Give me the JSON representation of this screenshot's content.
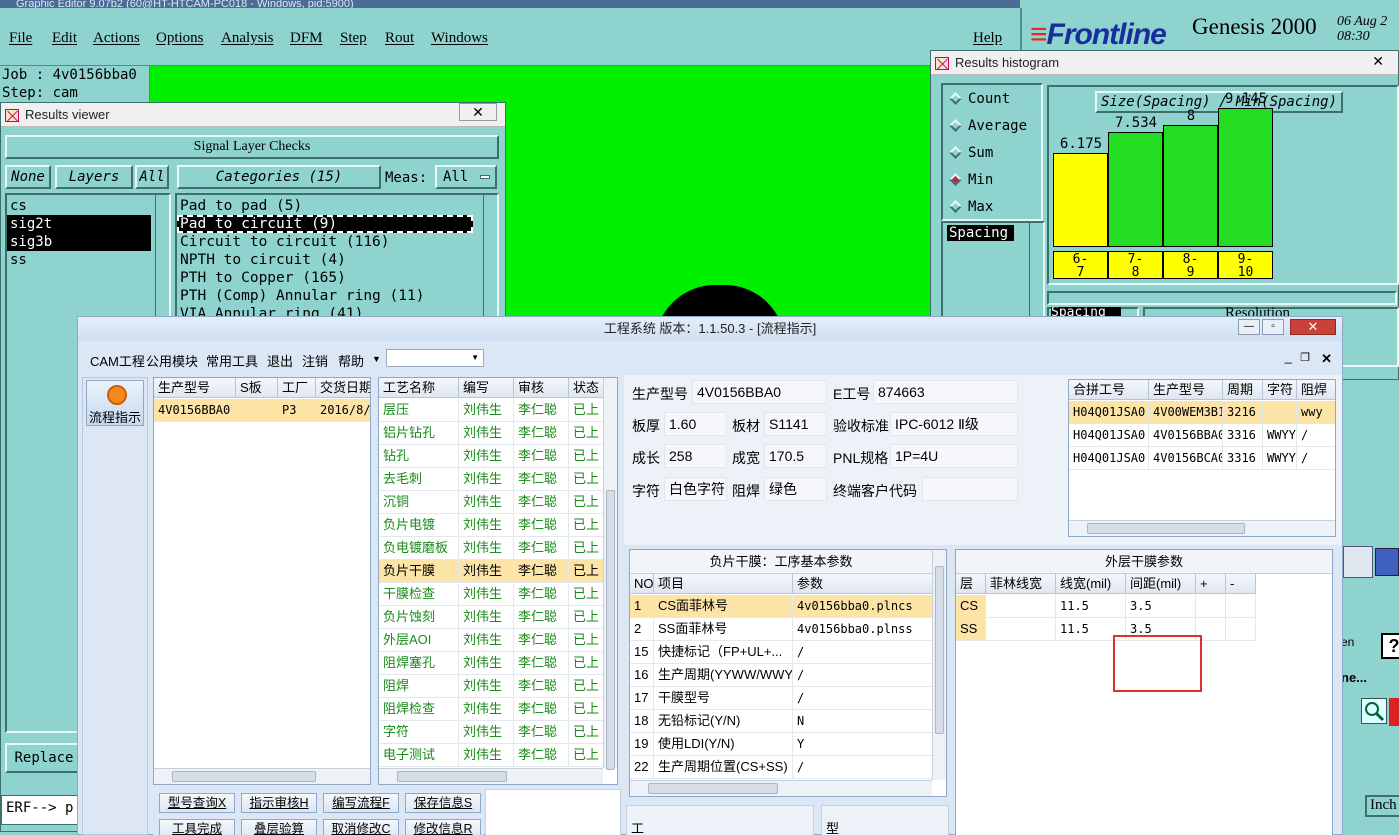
{
  "genesis": {
    "title_bar": "Graphic Editor 9.07b2 (60@HT-HTCAM-PC018 - Windows, pid:5900)",
    "menu": [
      "File",
      "Edit",
      "Actions",
      "Options",
      "Analysis",
      "DFM",
      "Step",
      "Rout",
      "Windows"
    ],
    "help": "Help",
    "brand": "Frontline",
    "product": "Genesis 2000",
    "date": "06 Aug 2",
    "time": "08:30",
    "job_label": "Job : 4v0156bba0",
    "step_label": "Step: cam"
  },
  "results_viewer": {
    "title": "Results viewer",
    "close": "✕",
    "header": "Signal Layer Checks",
    "none_btn": "None",
    "layers_btn": "Layers",
    "all_btn": "All",
    "categories_btn": "Categories (15)",
    "meas_label": "Meas:",
    "meas_value": "All",
    "layers": [
      {
        "name": "cs",
        "selected": false
      },
      {
        "name": "sig2t",
        "selected": true
      },
      {
        "name": "sig3b",
        "selected": true
      },
      {
        "name": "ss",
        "selected": false
      }
    ],
    "categories": [
      {
        "label": "Pad to pad (5)",
        "selected": false
      },
      {
        "label": "Pad to circuit (9)",
        "selected": true
      },
      {
        "label": "Circuit to circuit (116)",
        "selected": false
      },
      {
        "label": "NPTH to circuit (4)",
        "selected": false
      },
      {
        "label": "PTH to Copper (165)",
        "selected": false
      },
      {
        "label": "PTH (Comp) Annular ring (11)",
        "selected": false
      },
      {
        "label": "VIA Annular ring (41)",
        "selected": false
      }
    ],
    "replace_btn": "Replace",
    "erf_label": "ERF--> p"
  },
  "histogram": {
    "title": "Results histogram",
    "close": "✕",
    "modes": [
      {
        "label": "Count",
        "on": false
      },
      {
        "label": "Average",
        "on": false
      },
      {
        "label": "Sum",
        "on": false
      },
      {
        "label": "Min",
        "on": true
      },
      {
        "label": "Max",
        "on": false
      }
    ],
    "measure": "Spacing",
    "resolution_label": "Resolution",
    "stepper_label": "Spacing",
    "extra_right_1": "en",
    "extra_right_2": "ne...",
    "inch_label": "Inch",
    "help_icon": "?"
  },
  "chart_data": {
    "type": "bar",
    "title": "Size(Spacing) / Min(Spacing)",
    "categories": [
      "6-7",
      "7-8",
      "8-9",
      "9-10"
    ],
    "category_lines": [
      [
        "6-",
        "7"
      ],
      [
        "7-",
        "8"
      ],
      [
        "8-",
        "9"
      ],
      [
        "9-",
        "10"
      ]
    ],
    "values": [
      6.175,
      7.534,
      8,
      9.145
    ],
    "value_labels": [
      "6.175",
      "7.534",
      "8",
      "9.145"
    ],
    "colors": [
      "#ffff00",
      "#22dd22",
      "#22dd22",
      "#22dd22"
    ],
    "ylim": [
      0,
      10.5
    ]
  },
  "app": {
    "title": "工程系统    版本：1.1.50.3 - [流程指示]",
    "menu": [
      "CAM工程",
      "公用模块",
      "常用工具",
      "退出",
      "注销",
      "帮助"
    ],
    "nav_btn": "流程指示",
    "orders": {
      "headers": [
        "生产型号",
        "S板",
        "工厂",
        "交货日期"
      ],
      "rows": [
        [
          "4V0156BBA0",
          "",
          "P3",
          "2016/8/"
        ]
      ]
    },
    "process": {
      "headers": [
        "工艺名称",
        "编写",
        "审核",
        "状态"
      ],
      "rows": [
        [
          "层压",
          "刘伟生",
          "李仁聪",
          "已上"
        ],
        [
          "铝片钻孔",
          "刘伟生",
          "李仁聪",
          "已上"
        ],
        [
          "钻孔",
          "刘伟生",
          "李仁聪",
          "已上"
        ],
        [
          "去毛刺",
          "刘伟生",
          "李仁聪",
          "已上"
        ],
        [
          "沉铜",
          "刘伟生",
          "李仁聪",
          "已上"
        ],
        [
          "负片电镀",
          "刘伟生",
          "李仁聪",
          "已上"
        ],
        [
          "负电镀磨板",
          "刘伟生",
          "李仁聪",
          "已上"
        ],
        [
          "负片干膜",
          "刘伟生",
          "李仁聪",
          "已上"
        ],
        [
          "干膜检查",
          "刘伟生",
          "李仁聪",
          "已上"
        ],
        [
          "负片蚀刻",
          "刘伟生",
          "李仁聪",
          "已上"
        ],
        [
          "外层AOI",
          "刘伟生",
          "李仁聪",
          "已上"
        ],
        [
          "阻焊塞孔",
          "刘伟生",
          "李仁聪",
          "已上"
        ],
        [
          "阻焊",
          "刘伟生",
          "李仁聪",
          "已上"
        ],
        [
          "阻焊检查",
          "刘伟生",
          "李仁聪",
          "已上"
        ],
        [
          "字符",
          "刘伟生",
          "李仁聪",
          "已上"
        ],
        [
          "电子测试",
          "刘伟生",
          "李仁聪",
          "已上"
        ]
      ],
      "selected_index": 7
    },
    "info": {
      "model_label": "生产型号",
      "model": "4V0156BBA0",
      "ework_label": "E工号",
      "ework": "874663",
      "thick_label": "板厚",
      "thick": "1.60",
      "material_label": "板材",
      "material": "S1141",
      "std_label": "验收标准",
      "std": "IPC-6012 Ⅱ级",
      "length_label": "成长",
      "length": "258",
      "width_label": "成宽",
      "width": "170.5",
      "pnl_label": "PNL规格",
      "pnl": "1P=4U",
      "silk_label": "字符",
      "silk": "白色字符",
      "mask_label": "阻焊",
      "mask": "绿色",
      "cust_label": "终端客户代码",
      "cust": ""
    },
    "merge": {
      "headers": [
        "合拼工号",
        "生产型号",
        "周期",
        "字符",
        "阻焊"
      ],
      "rows": [
        [
          "H04Q01JSA0",
          "4V00WEM3B1",
          "3216",
          "",
          "wwy"
        ],
        [
          "H04Q01JSA0",
          "4V0156BBA0",
          "3316",
          "WWYY",
          "/"
        ],
        [
          "H04Q01JSA0",
          "4V0156BCA0",
          "3316",
          "WWYY",
          "/"
        ]
      ]
    },
    "film": {
      "title": "负片干膜：工序基本参数",
      "headers": [
        "NO",
        "项目",
        "参数"
      ],
      "rows": [
        [
          "1",
          "CS面菲林号",
          "4v0156bba0.plncs"
        ],
        [
          "2",
          "SS面菲林号",
          "4v0156bba0.plnss"
        ],
        [
          "15",
          "快捷标记（FP+UL+...",
          "/"
        ],
        [
          "16",
          "生产周期(YYWW/WWYY)",
          "/"
        ],
        [
          "17",
          "干膜型号",
          "/"
        ],
        [
          "18",
          "无铅标记(Y/N)",
          "N"
        ],
        [
          "19",
          "使用LDI(Y/N)",
          "Y"
        ],
        [
          "22",
          "生产周期位置(CS+SS)",
          "/"
        ]
      ]
    },
    "outer": {
      "title": "外层干膜参数",
      "headers": [
        "层",
        "菲林线宽",
        "线宽(mil)",
        "间距(mil)",
        "+",
        "-"
      ],
      "rows": [
        [
          "CS",
          "",
          "11.5",
          "3.5",
          "",
          ""
        ],
        [
          "SS",
          "",
          "11.5",
          "3.5",
          "",
          ""
        ]
      ]
    },
    "buttons": [
      "型号查询X",
      "指示审核H",
      "编写流程F",
      "保存信息S",
      "工具完成",
      "叠层验算",
      "取消修改C",
      "修改信息R"
    ],
    "bottom_labels": [
      "工",
      "型"
    ]
  }
}
